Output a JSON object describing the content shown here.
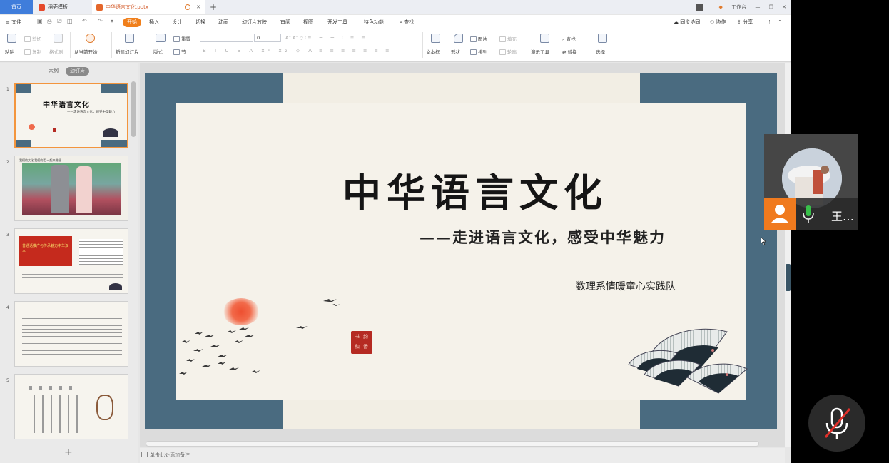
{
  "tabs": {
    "home": "首页",
    "template": "稻壳模板",
    "document": "中华语言文化.pptx",
    "add": "+"
  },
  "window": {
    "workspace": "工作台",
    "minimize": "—",
    "restore": "❐",
    "close": "✕"
  },
  "menu": {
    "file": "文件",
    "items": [
      "开始",
      "插入",
      "设计",
      "切换",
      "动画",
      "幻灯片放映",
      "审阅",
      "视图",
      "开发工具",
      "特色功能"
    ],
    "search": "查找",
    "sync": "同步协同",
    "cooperate": "协作",
    "share": "分享"
  },
  "ribbon": {
    "paste": "粘贴",
    "cut": "剪切",
    "copy": "复制",
    "format_painter": "格式刷",
    "from_current": "从当前开始",
    "new_slide": "新建幻灯片",
    "layout": "版式",
    "section": "节",
    "reset": "重置",
    "font_size": "0",
    "textbox": "文本框",
    "shape": "形状",
    "picture": "图片",
    "arrange": "排列",
    "fill": "填充",
    "outline": "轮廓",
    "presentation_tools": "演示工具",
    "find": "查找",
    "replace": "替换",
    "select": "选择"
  },
  "panel": {
    "outline_tab": "大纲",
    "slides_tab": "幻灯片",
    "numbers": [
      "1",
      "2",
      "3",
      "4",
      "5"
    ],
    "thumb1_title": "中华语言文化",
    "thumb1_sub": "——走进语言文化，感受中华魅力",
    "thumb2_text": "我们的文化 我们的话 一起来说吧",
    "thumb3_banner": "普通话推广与传承魅力中华汉字",
    "add": "+"
  },
  "slide": {
    "title": "中华语言文化",
    "subtitle": "——走进语言文化，感受中华魅力",
    "team": "数理系情暖童心实践队",
    "seal_text": [
      "书",
      "韵",
      "和",
      "香"
    ]
  },
  "notes": {
    "placeholder": "单击此处添加备注"
  },
  "meeting": {
    "participant_name": "王…"
  },
  "colors": {
    "accent": "#f07f1b",
    "home_tab": "#3f7ddb",
    "slide_frame": "#4a6b80",
    "seal": "#b52a22"
  }
}
